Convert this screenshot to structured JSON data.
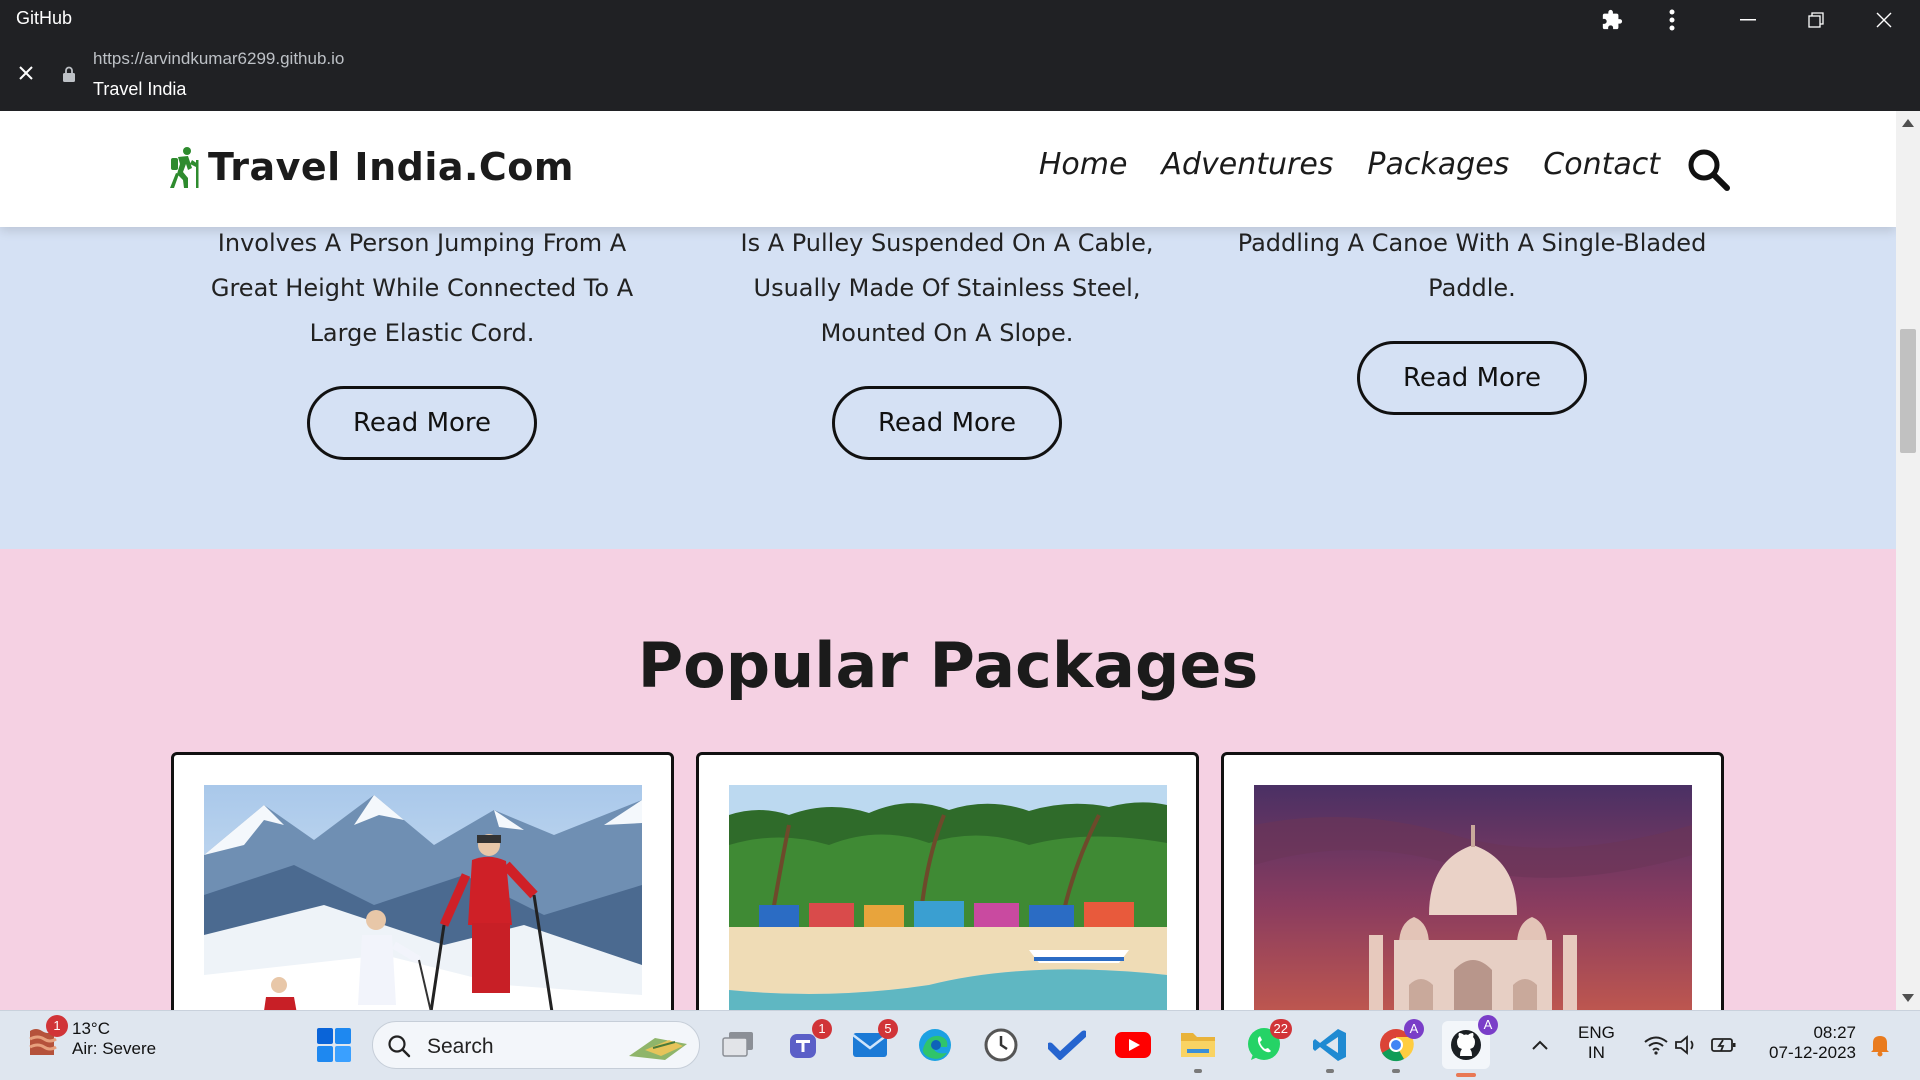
{
  "browser": {
    "app_title": "GitHub",
    "url": "https://arvindkumar6299.github.io",
    "page_title": "Travel India"
  },
  "header": {
    "logo_text": "Travel India.Com",
    "nav": [
      "Home",
      "Adventures",
      "Packages",
      "Contact"
    ]
  },
  "adventures": {
    "cards": [
      {
        "text": "Involves A Person Jumping From A Great Height While Connected To A Large Elastic Cord.",
        "button": "Read More"
      },
      {
        "text": "Is A Pulley Suspended On A Cable, Usually Made Of Stainless Steel, Mounted On A Slope.",
        "button": "Read More"
      },
      {
        "text": "Paddling A Canoe With A Single-Bladed Paddle.",
        "button": "Read More"
      }
    ]
  },
  "packages": {
    "title": "Popular Packages"
  },
  "taskbar": {
    "weather_temp": "13°C",
    "weather_status": "Air: Severe",
    "weather_badge": "1",
    "search_label": "Search",
    "badges": {
      "teams": "1",
      "mail": "5",
      "whatsapp": "22",
      "chrome": "A",
      "github": "A"
    },
    "lang_top": "ENG",
    "lang_bottom": "IN",
    "time": "08:27",
    "date": "07-12-2023"
  },
  "colors": {
    "adventures_bg": "#d5e1f4",
    "packages_bg": "#f5d1e3",
    "logo_green": "#2e8b2e",
    "chrome_bg": "#202124"
  }
}
